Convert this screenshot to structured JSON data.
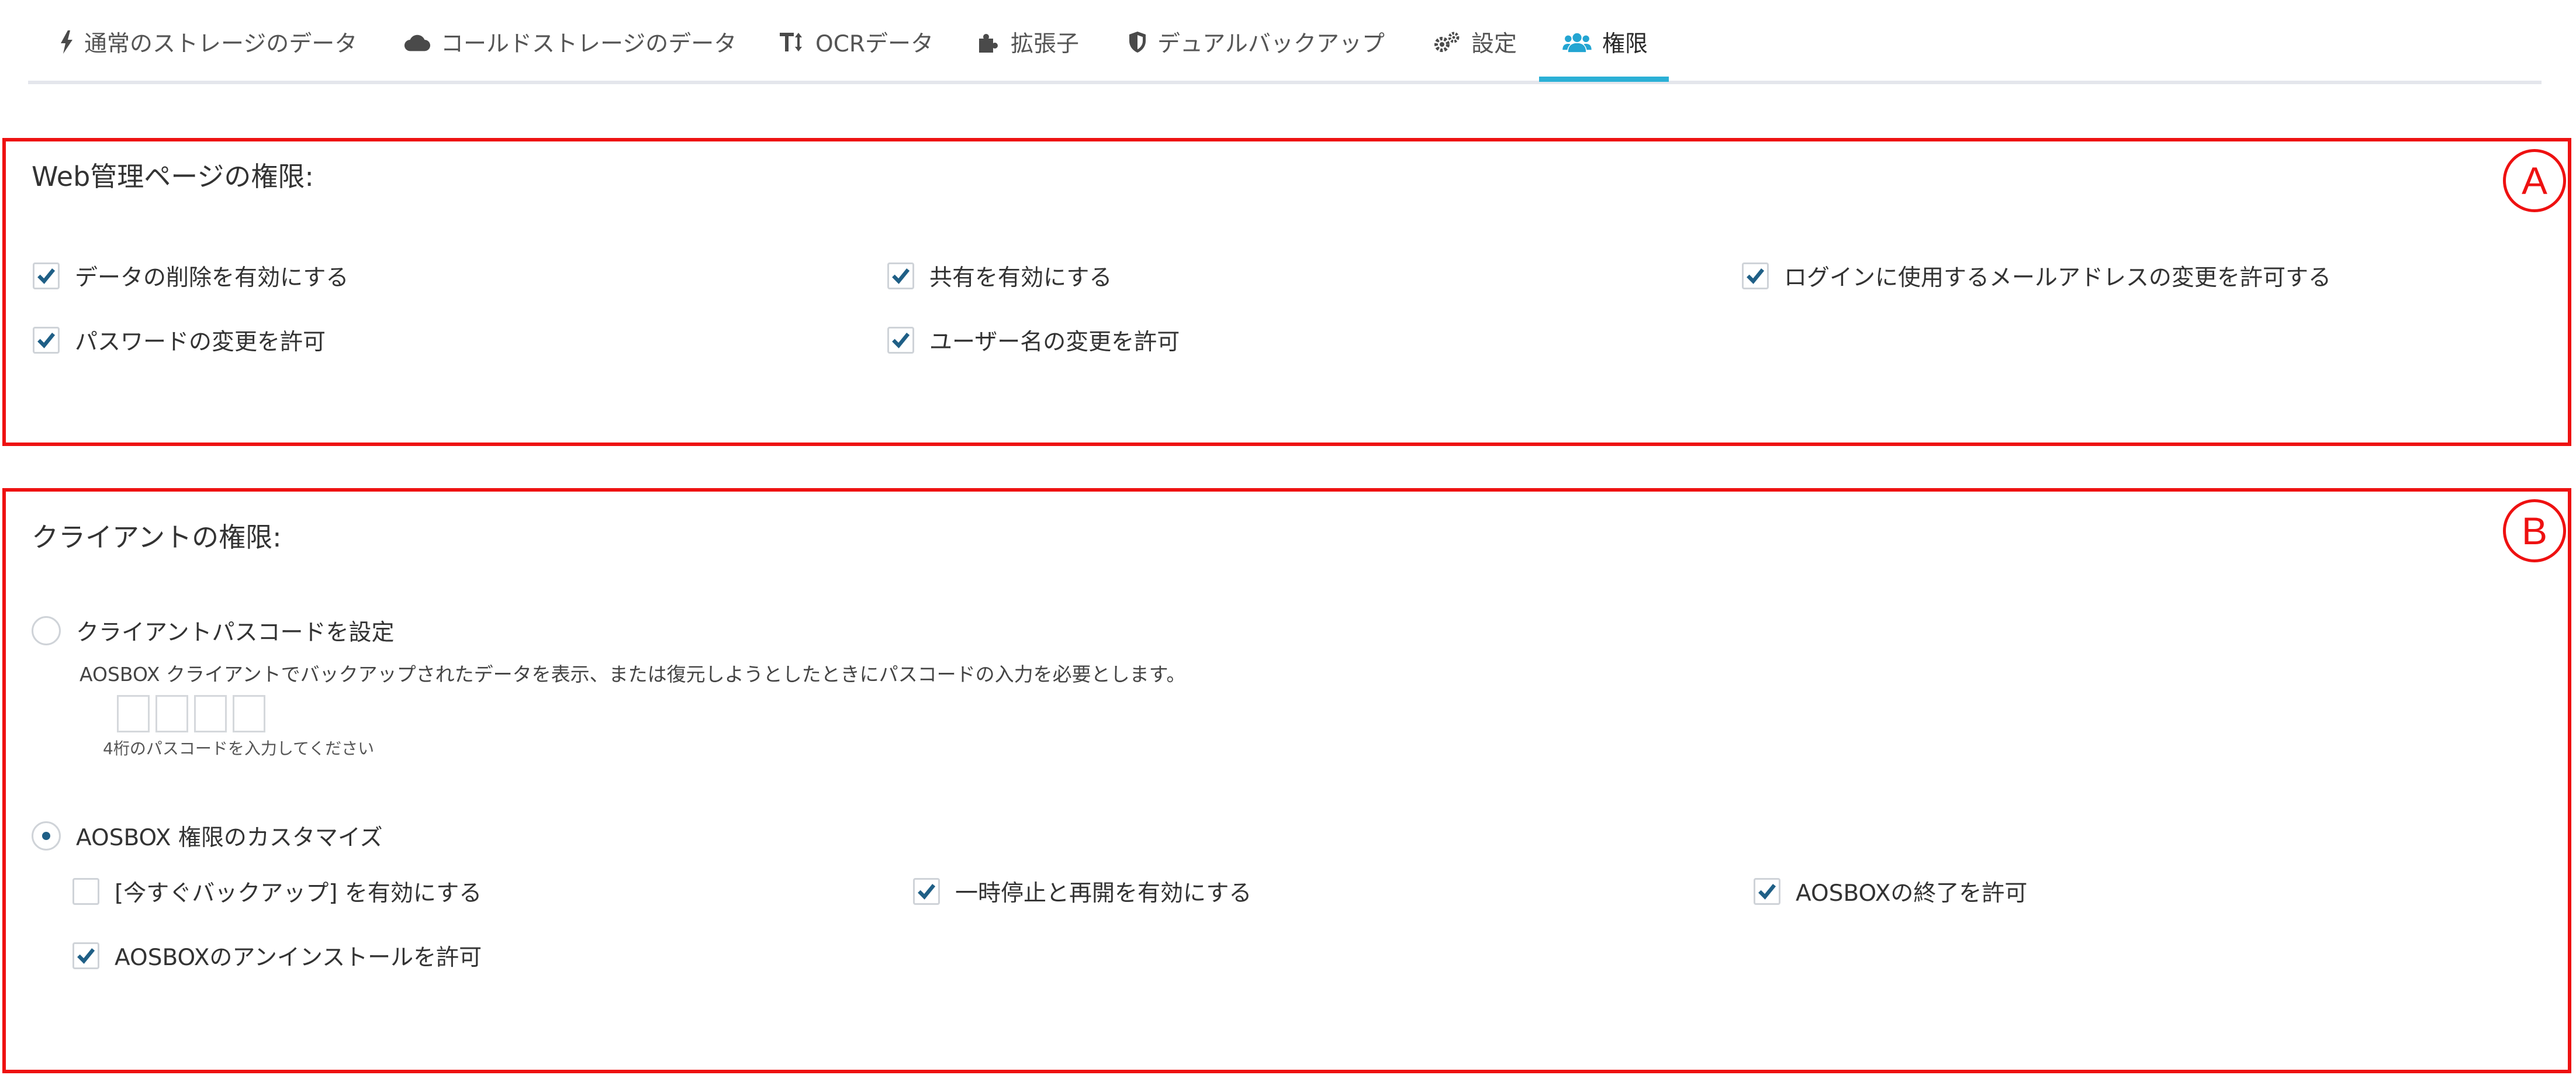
{
  "tabs": [
    {
      "label": "通常のストレージのデータ",
      "icon": "lightning-icon"
    },
    {
      "label": "コールドストレージのデータ",
      "icon": "cloud-icon"
    },
    {
      "label": "OCRデータ",
      "icon": "text-height-icon"
    },
    {
      "label": "拡張子",
      "icon": "puzzle-icon"
    },
    {
      "label": "デュアルバックアップ",
      "icon": "shield-icon"
    },
    {
      "label": "設定",
      "icon": "gears-icon"
    },
    {
      "label": "権限",
      "icon": "users-icon",
      "active": true
    }
  ],
  "accent_color": "#2bb0d6",
  "annotation_color": "#ee1111",
  "web_permissions": {
    "marker": "A",
    "title": "Web管理ページの権限:",
    "options": [
      {
        "label": "データの削除を有効にする",
        "checked": true
      },
      {
        "label": "共有を有効にする",
        "checked": true
      },
      {
        "label": "ログインに使用するメールアドレスの変更を許可する",
        "checked": true
      },
      {
        "label": "パスワードの変更を許可",
        "checked": true
      },
      {
        "label": "ユーザー名の変更を許可",
        "checked": true
      }
    ]
  },
  "client_permissions": {
    "marker": "B",
    "title": "クライアントの権限:",
    "passcode": {
      "label": "クライアントパスコードを設定",
      "selected": false,
      "description": "AOSBOX クライアントでバックアップされたデータを表示、または復元しようとしたときにパスコードの入力を必要とします。",
      "hint": "4桁のパスコードを入力してください",
      "digits": [
        "",
        "",
        "",
        ""
      ]
    },
    "custom": {
      "label": "AOSBOX 権限のカスタマイズ",
      "selected": true,
      "options": [
        {
          "label": "[今すぐバックアップ] を有効にする",
          "checked": false
        },
        {
          "label": "一時停止と再開を有効にする",
          "checked": true
        },
        {
          "label": "AOSBOXの終了を許可",
          "checked": true
        },
        {
          "label": "AOSBOXのアンインストールを許可",
          "checked": true
        }
      ]
    }
  }
}
